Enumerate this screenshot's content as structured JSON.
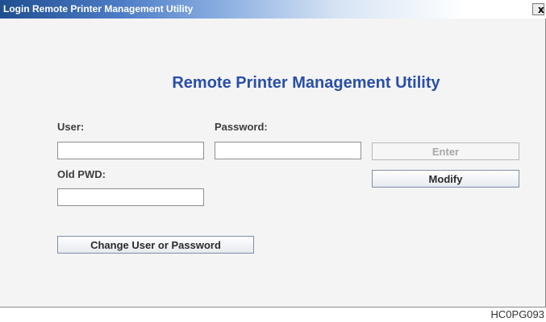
{
  "window": {
    "title": "Login Remote Printer Management Utility",
    "close_label": "x"
  },
  "main": {
    "heading": "Remote Printer Management Utility"
  },
  "form": {
    "user_label": "User:",
    "user_value": "",
    "password_label": "Password:",
    "password_value": "",
    "old_pwd_label": "Old PWD:",
    "old_pwd_value": ""
  },
  "buttons": {
    "enter": "Enter",
    "modify": "Modify",
    "change": "Change User or Password"
  },
  "footer": {
    "code": "HC0PG093"
  },
  "colors": {
    "heading": "#2a4fa8",
    "titlebar_start": "#1f4e8f"
  }
}
